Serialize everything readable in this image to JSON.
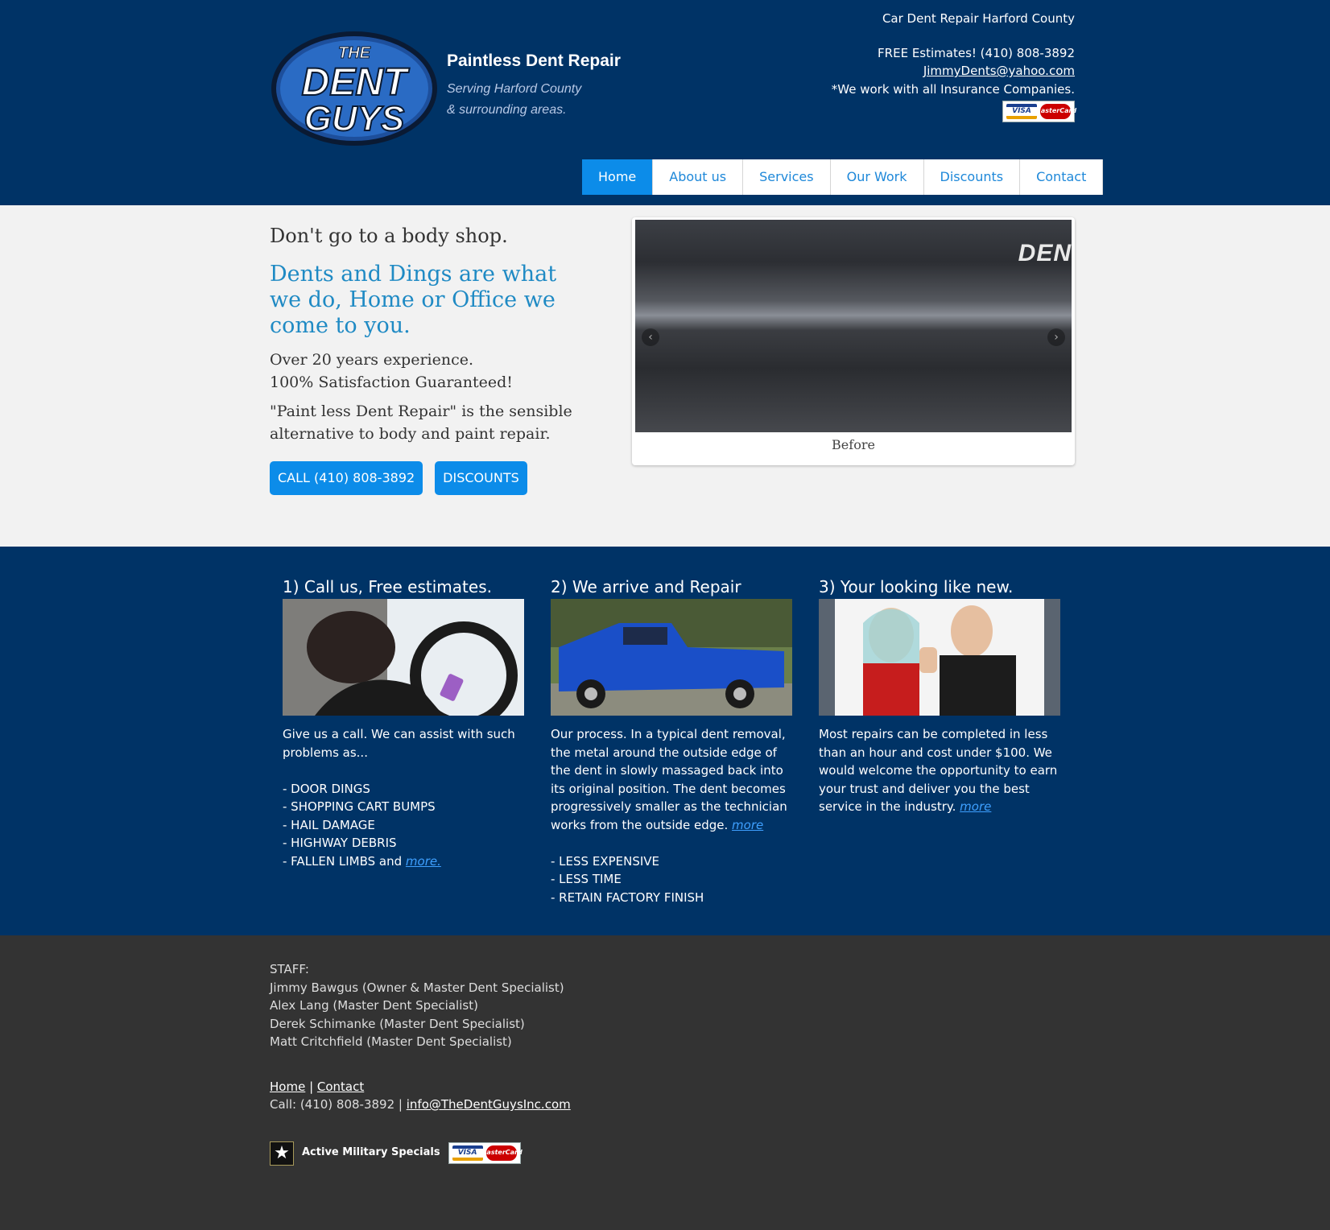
{
  "header": {
    "logo_text": "THE DENT GUYS",
    "tagline_title": "Paintless Dent Repair",
    "tagline_line1": "Serving Harford County",
    "tagline_line2": "& surrounding areas.",
    "top_right": "Car Dent Repair Harford County",
    "estimates": "FREE Estimates! (410) 808-3892",
    "email": "JimmyDents@yahoo.com",
    "insurance": "*We work with all Insurance Companies.",
    "card_visa": "VISA",
    "card_mc": "MasterCard"
  },
  "nav": [
    {
      "label": "Home",
      "active": true
    },
    {
      "label": "About us"
    },
    {
      "label": "Services"
    },
    {
      "label": "Our Work"
    },
    {
      "label": "Discounts"
    },
    {
      "label": "Contact"
    }
  ],
  "hero": {
    "lead": "Don't go to a body shop.",
    "blue": "Dents and Dings are what we do, Home or Office we come to you.",
    "line1": "Over 20 years experience.",
    "line2": "100% Satisfaction Guaranteed!",
    "para": "\"Paint less Dent Repair\" is the sensible alternative to body and paint repair.",
    "btn_call": "CALL (410) 808-3892",
    "btn_discounts": "DISCOUNTS"
  },
  "slider": {
    "image_text": "DEN",
    "caption": "Before",
    "dot_count": 12,
    "active_dot": 3
  },
  "steps": [
    {
      "title": "1) Call us, Free estimates.",
      "text": "Give us a call. We can assist with such problems as...",
      "list": [
        "- DOOR DINGS",
        "- SHOPPING CART BUMPS",
        "- HAIL DAMAGE",
        "- HIGHWAY DEBRIS"
      ],
      "last": "- FALLEN LIMBS and ",
      "more": "more."
    },
    {
      "title": "2) We arrive and Repair",
      "text": "Our process. In a typical dent removal, the metal around the outside edge of the dent in slowly massaged back into its original position. The dent becomes progressively smaller as the technician works from the outside edge. ",
      "more": "more",
      "list": [
        "- LESS EXPENSIVE",
        "- LESS TIME",
        "- RETAIN FACTORY FINISH"
      ]
    },
    {
      "title": "3) Your looking like new.",
      "text": "Most repairs can be completed in less than an hour and cost under $100. We would welcome the opportunity to earn your trust and deliver you the best service in the industry. ",
      "more": "more"
    }
  ],
  "footer": {
    "staff_label": "STAFF:",
    "staff": [
      "Jimmy Bawgus (Owner & Master Dent Specialist)",
      "Alex Lang (Master Dent Specialist)",
      "Derek Schimanke (Master Dent Specialist)",
      "Matt Critchfield (Master Dent Specialist)"
    ],
    "link_home": "Home",
    "sep": " | ",
    "link_contact": "Contact",
    "call": "Call: (410) 808-3892 | ",
    "email": "info@TheDentGuysInc.com",
    "military": "Active Military Specials"
  }
}
